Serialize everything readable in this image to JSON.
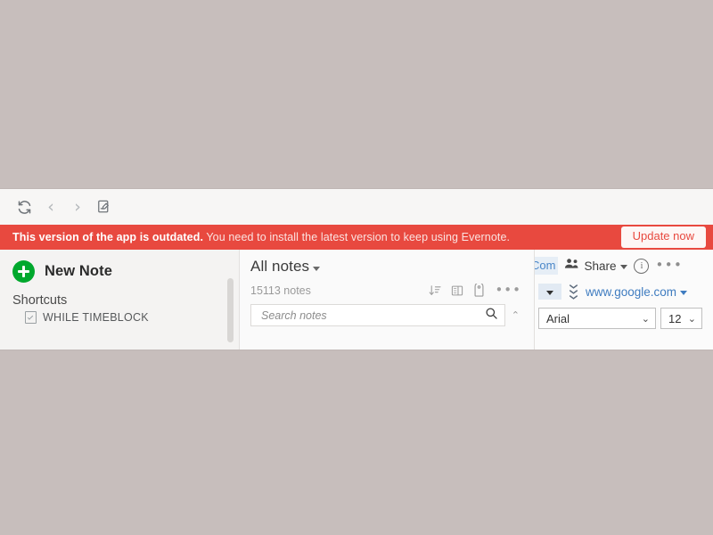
{
  "window": {
    "toolbar": {
      "sync_icon": "sync-refresh-icon",
      "back_icon": "chevron-left-icon",
      "forward_icon": "chevron-right-icon",
      "note_icon": "new-note-document-icon"
    },
    "banner": {
      "bold_text": "This version of the app is outdated.",
      "rest_text": " You need to install the latest version to keep using Evernote.",
      "button_label": "Update now",
      "background_color": "#e8493f",
      "button_text_color": "#e8493f"
    }
  },
  "sidebar": {
    "new_note_label": "New Note",
    "new_note_color": "#00a82d",
    "shortcuts_label": "Shortcuts",
    "shortcut_items": [
      {
        "label": "WHILE TIMEBLOCK",
        "icon": "note-check-icon"
      }
    ],
    "overlay_icon": "google-lens-icon"
  },
  "notes": {
    "title": "All notes",
    "count_label": "15113 notes",
    "icons": [
      {
        "name": "sort-order-icon"
      },
      {
        "name": "view-layout-icon"
      },
      {
        "name": "tag-label-icon"
      },
      {
        "name": "more-options-icon",
        "glyph": "•••"
      }
    ],
    "search_placeholder": "Search notes",
    "search_value": "",
    "collapse_glyph": "⌃"
  },
  "editor": {
    "comments_label": "Com",
    "comments_color": "#4a86c8",
    "share_label": "Share",
    "share_icon": "people-share-icon",
    "info_icon": "info-circle-icon",
    "info_glyph": "i",
    "more_glyph": "•••",
    "dropdown_icon": "dropdown-arrow-button",
    "double_chevron_icon": "double-chevron-down-icon",
    "url": "www.google.com",
    "url_color": "#3f7cc0",
    "font_family_value": "Arial",
    "font_size_value": "12",
    "select_chevron": "⌄"
  }
}
